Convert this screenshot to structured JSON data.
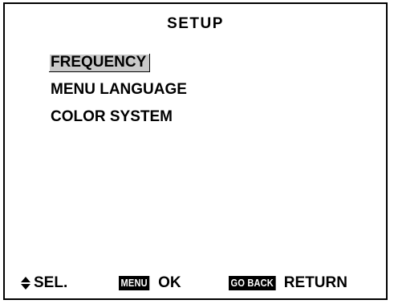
{
  "screen": {
    "title": "SETUP"
  },
  "menu": {
    "items": [
      {
        "label": "FREQUENCY",
        "selected": true
      },
      {
        "label": "MENU LANGUAGE",
        "selected": false
      },
      {
        "label": "COLOR SYSTEM",
        "selected": false
      }
    ]
  },
  "footer": {
    "select_icon": "up-down-arrow-icon",
    "select_label": "SEL.",
    "ok_key": "MENU",
    "ok_label": "OK",
    "return_key": "GO BACK",
    "return_label": "RETURN"
  },
  "colors": {
    "background": "#ffffff",
    "text": "#000000",
    "highlight": "#c9c9c9",
    "key_background": "#000000",
    "key_text": "#ffffff"
  }
}
